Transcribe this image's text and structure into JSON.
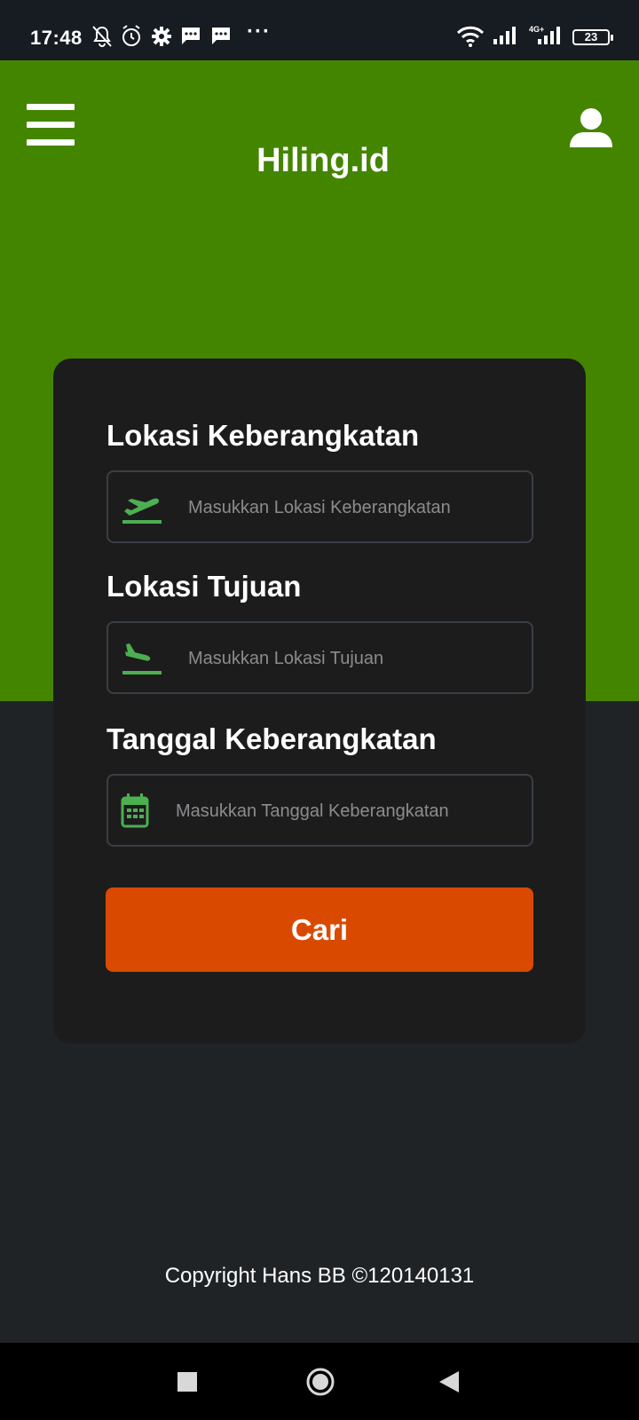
{
  "status_bar": {
    "time": "17:48",
    "icons": [
      "mute-alarm-icon",
      "alarm-icon",
      "settings-icon",
      "message-icon",
      "message-icon",
      "more-dots-icon",
      "wifi-icon",
      "signal-icon",
      "signal-4g-icon"
    ],
    "more": "···",
    "network_label": "4G+",
    "battery": "23"
  },
  "header": {
    "title": "Hiling.id",
    "menu_icon": "hamburger-menu-icon",
    "profile_icon": "user-icon",
    "color": "#448500"
  },
  "form": {
    "departure": {
      "label": "Lokasi Keberangkatan",
      "placeholder": "Masukkan Lokasi Keberangkatan",
      "value": "",
      "icon": "flight-takeoff-icon"
    },
    "destination": {
      "label": "Lokasi Tujuan",
      "placeholder": "Masukkan Lokasi Tujuan",
      "value": "",
      "icon": "flight-land-icon"
    },
    "date": {
      "label": "Tanggal Keberangkatan",
      "placeholder": "Masukkan Tanggal Keberangkatan",
      "value": "",
      "icon": "calendar-icon"
    },
    "search_button": "Cari",
    "accent_color": "#d94a00",
    "icon_color": "#4caf50"
  },
  "footer": {
    "copyright": "Copyright Hans BB ©120140131"
  },
  "nav_bar": {
    "recent": "recent-apps-icon",
    "home": "home-icon",
    "back": "back-icon"
  }
}
